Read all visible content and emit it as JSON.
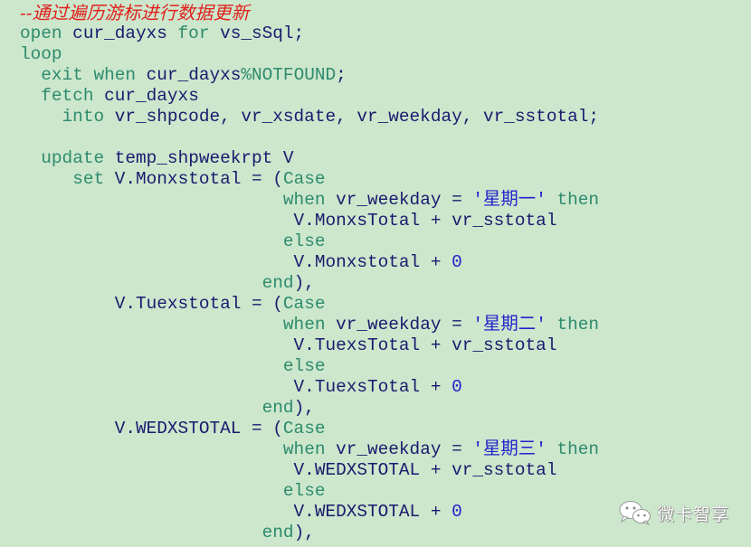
{
  "editor": {
    "background": "#cce7cc",
    "colors": {
      "keyword": "#2e8b6e",
      "identifier": "#1a1a6e",
      "comment": "#e0201c",
      "literal": "#2222cc"
    },
    "lines": [
      [
        {
          "t": "cm",
          "v": "--通过遍历游标进行数据更新"
        }
      ],
      [
        {
          "t": "kw",
          "v": "open"
        },
        {
          "t": "id",
          "v": " cur_dayxs "
        },
        {
          "t": "kw",
          "v": "for"
        },
        {
          "t": "id",
          "v": " vs_sSql;"
        }
      ],
      [
        {
          "t": "kw",
          "v": "loop"
        }
      ],
      [
        {
          "t": "id",
          "v": "  "
        },
        {
          "t": "kw",
          "v": "exit when"
        },
        {
          "t": "id",
          "v": " cur_dayxs"
        },
        {
          "t": "kw",
          "v": "%NOTFOUND"
        },
        {
          "t": "id",
          "v": ";"
        }
      ],
      [
        {
          "t": "id",
          "v": "  "
        },
        {
          "t": "kw",
          "v": "fetch"
        },
        {
          "t": "id",
          "v": " cur_dayxs"
        }
      ],
      [
        {
          "t": "id",
          "v": "    "
        },
        {
          "t": "kw",
          "v": "into"
        },
        {
          "t": "id",
          "v": " vr_shpcode, vr_xsdate, vr_weekday, vr_sstotal;"
        }
      ],
      [
        {
          "t": "id",
          "v": ""
        }
      ],
      [
        {
          "t": "id",
          "v": "  "
        },
        {
          "t": "kw",
          "v": "update"
        },
        {
          "t": "id",
          "v": " temp_shpweekrpt V"
        }
      ],
      [
        {
          "t": "id",
          "v": "     "
        },
        {
          "t": "kw",
          "v": "set"
        },
        {
          "t": "id",
          "v": " V.Monxstotal = ("
        },
        {
          "t": "kw",
          "v": "Case"
        }
      ],
      [
        {
          "t": "id",
          "v": "                         "
        },
        {
          "t": "kw",
          "v": "when"
        },
        {
          "t": "id",
          "v": " vr_weekday = "
        },
        {
          "t": "str",
          "v": "'星期一'"
        },
        {
          "t": "kw",
          "v": " then"
        }
      ],
      [
        {
          "t": "id",
          "v": "                          V.MonxsTotal + vr_sstotal"
        }
      ],
      [
        {
          "t": "id",
          "v": "                         "
        },
        {
          "t": "kw",
          "v": "else"
        }
      ],
      [
        {
          "t": "id",
          "v": "                          V.Monxstotal + "
        },
        {
          "t": "num",
          "v": "0"
        }
      ],
      [
        {
          "t": "id",
          "v": "                       "
        },
        {
          "t": "kw",
          "v": "end"
        },
        {
          "t": "id",
          "v": "),"
        }
      ],
      [
        {
          "t": "id",
          "v": "         V.Tuexstotal = ("
        },
        {
          "t": "kw",
          "v": "Case"
        }
      ],
      [
        {
          "t": "id",
          "v": "                         "
        },
        {
          "t": "kw",
          "v": "when"
        },
        {
          "t": "id",
          "v": " vr_weekday = "
        },
        {
          "t": "str",
          "v": "'星期二'"
        },
        {
          "t": "kw",
          "v": " then"
        }
      ],
      [
        {
          "t": "id",
          "v": "                          V.TuexsTotal + vr_sstotal"
        }
      ],
      [
        {
          "t": "id",
          "v": "                         "
        },
        {
          "t": "kw",
          "v": "else"
        }
      ],
      [
        {
          "t": "id",
          "v": "                          V.TuexsTotal + "
        },
        {
          "t": "num",
          "v": "0"
        }
      ],
      [
        {
          "t": "id",
          "v": "                       "
        },
        {
          "t": "kw",
          "v": "end"
        },
        {
          "t": "id",
          "v": "),"
        }
      ],
      [
        {
          "t": "id",
          "v": "         V.WEDXSTOTAL = ("
        },
        {
          "t": "kw",
          "v": "Case"
        }
      ],
      [
        {
          "t": "id",
          "v": "                         "
        },
        {
          "t": "kw",
          "v": "when"
        },
        {
          "t": "id",
          "v": " vr_weekday = "
        },
        {
          "t": "str",
          "v": "'星期三'"
        },
        {
          "t": "kw",
          "v": " then"
        }
      ],
      [
        {
          "t": "id",
          "v": "                          V.WEDXSTOTAL + vr_sstotal"
        }
      ],
      [
        {
          "t": "id",
          "v": "                         "
        },
        {
          "t": "kw",
          "v": "else"
        }
      ],
      [
        {
          "t": "id",
          "v": "                          V.WEDXSTOTAL + "
        },
        {
          "t": "num",
          "v": "0"
        }
      ],
      [
        {
          "t": "id",
          "v": "                       "
        },
        {
          "t": "kw",
          "v": "end"
        },
        {
          "t": "id",
          "v": "),"
        }
      ]
    ]
  },
  "watermark": {
    "icon": "wechat-icon",
    "text": "微卡智享"
  }
}
